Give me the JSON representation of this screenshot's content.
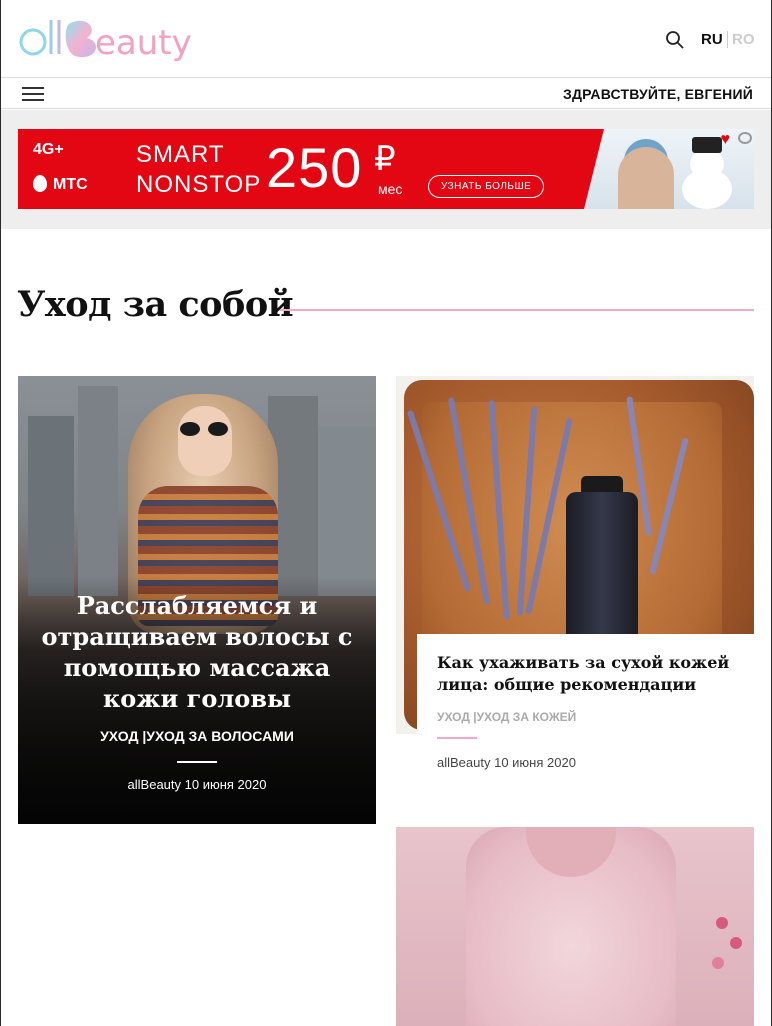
{
  "header": {
    "logo": {
      "prefix": "all",
      "rest": "eauty",
      "colors": [
        "#7fd3e6",
        "#f0a5c8",
        "#c9b6e8"
      ]
    },
    "search_icon": "search-icon",
    "lang": {
      "active": "RU",
      "inactive": "RO"
    }
  },
  "nav": {
    "menu_icon": "hamburger-menu-icon",
    "greeting": "ЗДРАВСТВУЙТЕ, ЕВГЕНИЙ"
  },
  "ad": {
    "badge_4g": "4G+",
    "brand": "МТС",
    "line1": "SMART",
    "line2": "NONSTOP",
    "price": "250",
    "currency": "₽",
    "period": "мес",
    "cta": "УЗНАТЬ БОЛЬШЕ",
    "brand_color": "#e30613"
  },
  "section": {
    "title": "Уход за собой",
    "accent_color": "#f3aac8"
  },
  "articles": [
    {
      "title": "Расслабляемся и отращиваем волосы с помощью массажа кожи головы",
      "category1": "УХОД",
      "separator": "|",
      "category2": "УХОД ЗА ВОЛОСАМИ",
      "meta": "allBeauty 10 июня 2020"
    },
    {
      "title": "Как ухаживать за сухой кожей лица: общие рекомендации",
      "category1": "УХОД",
      "separator": "|",
      "category2": "УХОД ЗА КОЖЕЙ",
      "meta": "allBeauty 10 июня 2020"
    }
  ]
}
